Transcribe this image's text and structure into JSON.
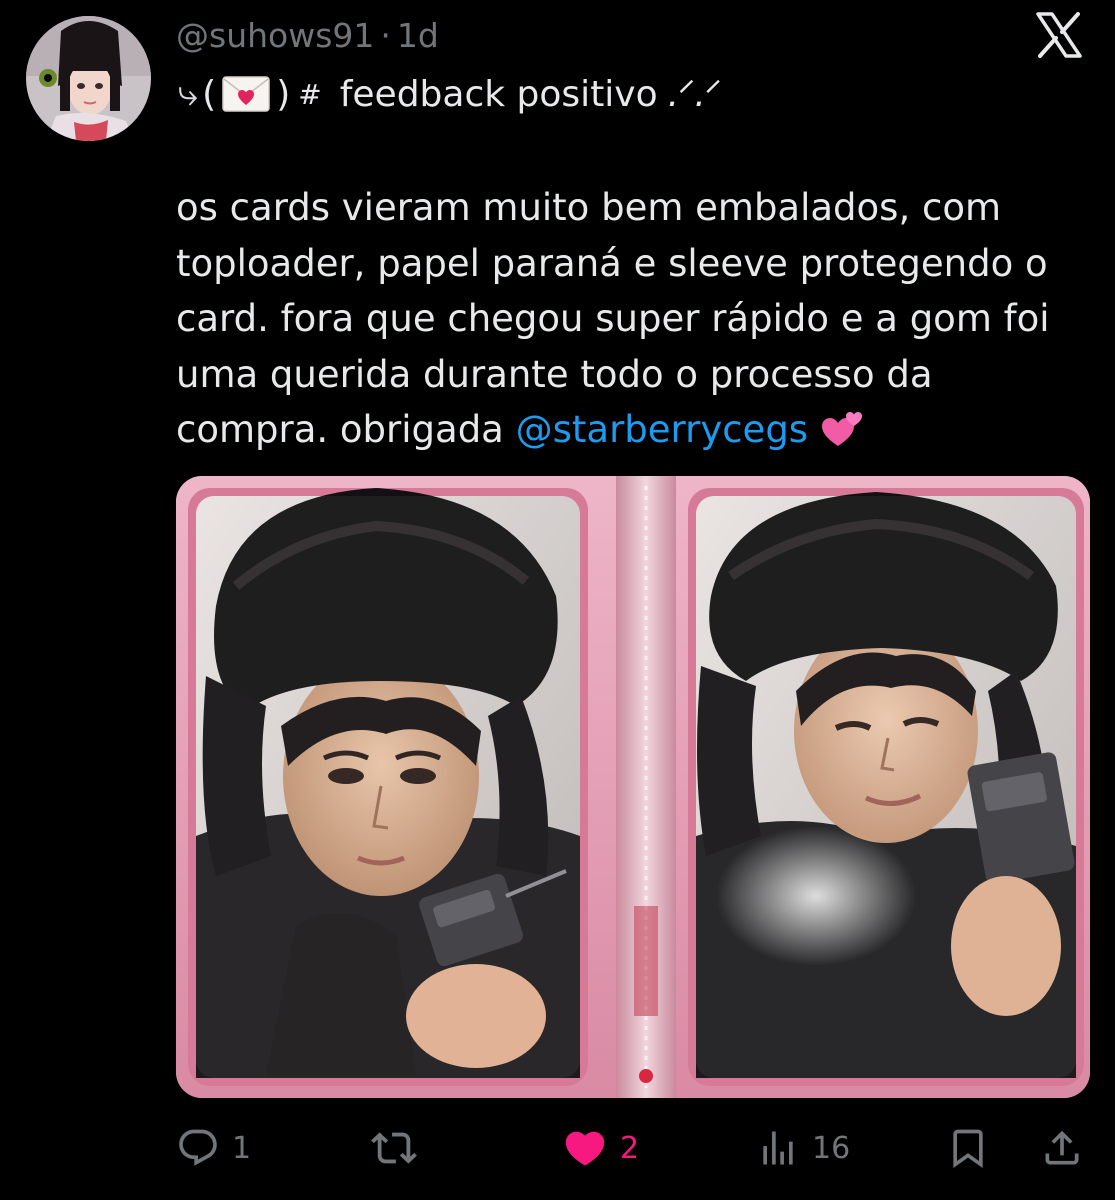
{
  "tweet": {
    "handle": "@suhows91",
    "separator": "·",
    "time": "1d",
    "title": {
      "hook": "⤷",
      "open_paren": "(",
      "close_paren": ")",
      "hash": "#",
      "text": "feedback positivo",
      "sparkle": ".ᐟ.ᐟ"
    },
    "body_text": "os cards vieram muito bem embalados, com\ntoploader, papel paraná e sleeve protegendo o\ncard. fora que chegou super rápido e a gom foi\numa querida durante todo o processo da\ncompra. obrigada ",
    "mention": "@starberrycegs",
    "emoji": "two-hearts"
  },
  "actions": {
    "reply": {
      "icon": "reply-icon",
      "count": "1"
    },
    "retweet": {
      "icon": "retweet-icon",
      "count": ""
    },
    "like": {
      "icon": "heart-icon",
      "count": "2",
      "liked": true
    },
    "views": {
      "icon": "views-icon",
      "count": "16"
    },
    "bookmark": {
      "icon": "bookmark-icon"
    },
    "share": {
      "icon": "share-icon"
    }
  },
  "colors": {
    "background": "#000000",
    "text": "#e7e9ea",
    "muted": "#71767b",
    "link": "#1d9bf0",
    "like": "#f91880",
    "binder_pink": "#e7a9bd"
  }
}
